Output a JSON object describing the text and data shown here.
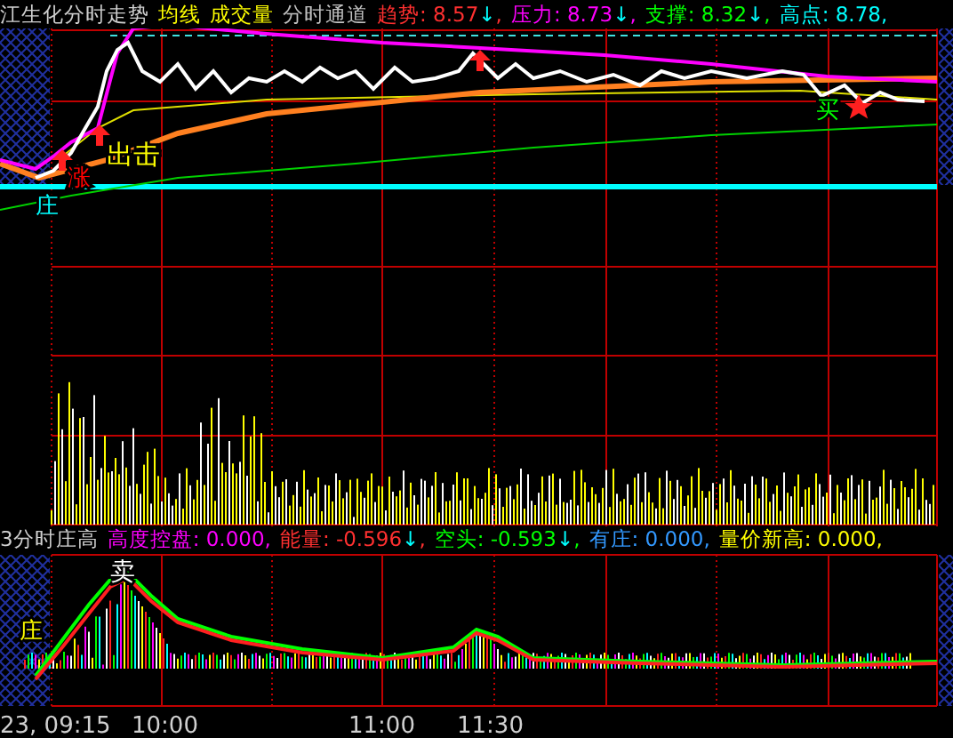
{
  "header": {
    "title": "江生化分时走势",
    "links": [
      {
        "text": "均线",
        "color": "#ffff00"
      },
      {
        "text": "成交量",
        "color": "#ffff00"
      },
      {
        "text": "分时通道",
        "color": "#c0c0c0"
      }
    ],
    "readings": [
      {
        "text": "趋势: 8.57",
        "arrow": "↓",
        "suffix": ",",
        "color": "#ff3030"
      },
      {
        "text": "压力: 8.73",
        "arrow": "↓",
        "suffix": ",",
        "color": "#ff00ff"
      },
      {
        "text": "支撑: 8.32",
        "arrow": "↓",
        "suffix": ",",
        "color": "#00ff00"
      },
      {
        "text": "高点: 8.78,",
        "color": "#00ffff"
      }
    ]
  },
  "chart_marks": [
    {
      "text": "出击",
      "color": "#ffff00"
    },
    {
      "text": "涨",
      "color": "#ff0000"
    },
    {
      "text": "庄",
      "color": "#00ffff"
    },
    {
      "text": "买",
      "color": "#00ff00"
    }
  ],
  "indicator": {
    "title": "3分时庄高",
    "readings": [
      {
        "text": "高度控盘: 0.000,",
        "color": "#ff00ff"
      },
      {
        "text": "能量: -0.596",
        "arrow": "↓",
        "suffix": ",",
        "color": "#ff3030"
      },
      {
        "text": "空头: -0.593",
        "arrow": "↓",
        "suffix": ",",
        "color": "#00ff00"
      },
      {
        "text": "有庄: 0.000,",
        "color": "#3399ff"
      },
      {
        "text": "量价新高: 0.000,",
        "color": "#ffff00"
      }
    ]
  },
  "lower_marks": [
    {
      "text": "卖",
      "color": "#ffffff"
    },
    {
      "text": "庄",
      "color": "#ffff00"
    }
  ],
  "time_axis": [
    "23, 09:15",
    "10:00",
    "11:00",
    "11:30"
  ]
}
